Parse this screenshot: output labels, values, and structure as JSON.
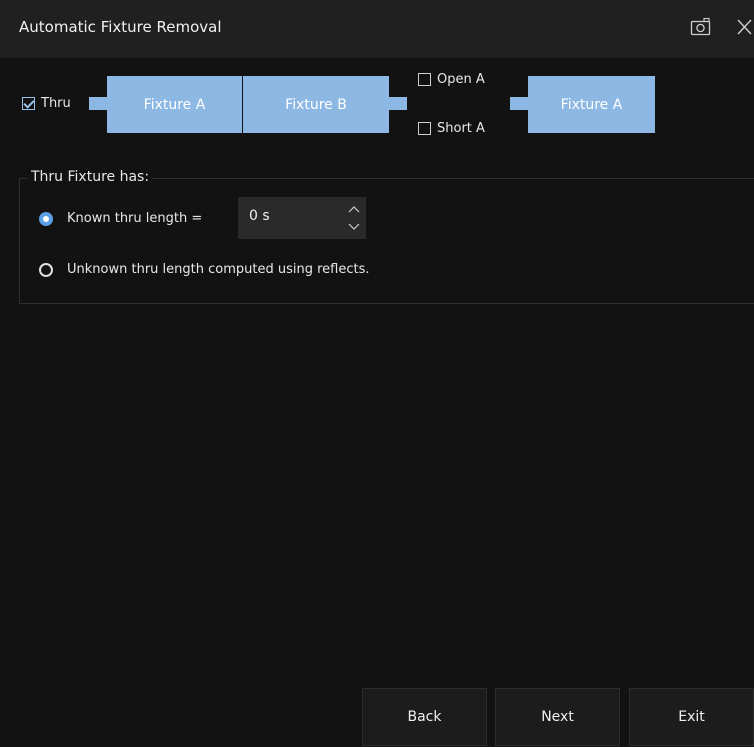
{
  "window": {
    "title": "Automatic Fixture Removal"
  },
  "diagram": {
    "thru_label": "Thru",
    "thru_checked": true,
    "fixture_a_left": "Fixture A",
    "fixture_b": "Fixture B",
    "open_label": "Open A",
    "open_checked": false,
    "short_label": "Short A",
    "short_checked": false,
    "fixture_a_right": "Fixture A",
    "fixture_color": "#8db8e3"
  },
  "thru_group": {
    "legend": "Thru Fixture has:",
    "known_label": "Known thru length =",
    "known_selected": true,
    "length_value": "0 s",
    "unknown_label": "Unknown thru length computed using reflects.",
    "unknown_selected": false
  },
  "footer": {
    "back_label": "Back",
    "next_label": "Next",
    "exit_label": "Exit"
  },
  "colors": {
    "background": "#121212",
    "titlebar": "#202020",
    "accent": "#5b9ee6"
  }
}
